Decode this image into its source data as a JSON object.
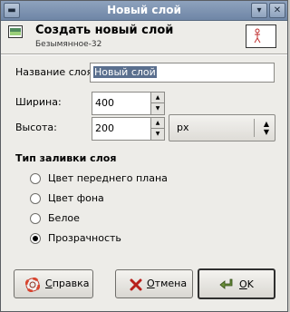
{
  "window": {
    "title": "Новый слой",
    "buttons": [
      "menu",
      "minimize",
      "close"
    ]
  },
  "header": {
    "title": "Создать новый слой",
    "subtitle": "Безымянное-32"
  },
  "form": {
    "layer_name_label": "Название слоя:",
    "layer_name_value": "Новый слой",
    "width_label": "Ширина:",
    "width_value": "400",
    "height_label": "Высота:",
    "height_value": "200",
    "unit_value": "px"
  },
  "fill": {
    "section_title": "Тип заливки слоя",
    "options": [
      {
        "label": "Цвет переднего плана",
        "selected": false
      },
      {
        "label": "Цвет фона",
        "selected": false
      },
      {
        "label": "Белое",
        "selected": false
      },
      {
        "label": "Прозрачность",
        "selected": true
      }
    ]
  },
  "buttons": {
    "help": "Справка",
    "cancel": "Отмена",
    "ok": "OK"
  },
  "colors": {
    "titlebar": "#7a8fad",
    "dialog_bg": "#edece8",
    "selection": "#5a6f8e"
  }
}
